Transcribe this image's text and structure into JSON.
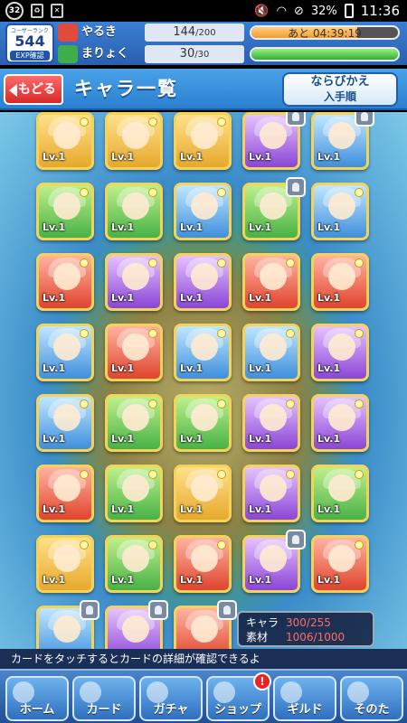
{
  "status_bar": {
    "notification_count": "32",
    "battery_percent": "32%",
    "time": "11:36"
  },
  "header": {
    "rank_label": "ユーザーランク",
    "rank_value": "544",
    "exp_label": "EXP確認",
    "stamina": {
      "name": "やるき",
      "current": "144",
      "max": "/200",
      "timer": "あと 04:39:19",
      "fill": 0.72
    },
    "magic": {
      "name": "まりょく",
      "current": "30",
      "max": "/30",
      "fill": 1.0
    }
  },
  "titlebar": {
    "back_label": "もどる",
    "title": "キャラ一覧",
    "sort_label": "ならびかえ",
    "sort_value": "入手順"
  },
  "cards": [
    {
      "color": "yellow",
      "lv": "Lv.1"
    },
    {
      "color": "yellow",
      "lv": "Lv.1"
    },
    {
      "color": "yellow",
      "lv": "Lv.1"
    },
    {
      "color": "purple",
      "lv": "Lv.1",
      "locked": true
    },
    {
      "color": "blue",
      "lv": "Lv.1",
      "locked": true
    },
    {
      "color": "green",
      "lv": "Lv.1"
    },
    {
      "color": "green",
      "lv": "Lv.1"
    },
    {
      "color": "blue",
      "lv": "Lv.1"
    },
    {
      "color": "green",
      "lv": "Lv.1",
      "locked": true
    },
    {
      "color": "blue",
      "lv": "Lv.1"
    },
    {
      "color": "red",
      "lv": "Lv.1"
    },
    {
      "color": "purple",
      "lv": "Lv.1"
    },
    {
      "color": "purple",
      "lv": "Lv.1"
    },
    {
      "color": "red",
      "lv": "Lv.1"
    },
    {
      "color": "red",
      "lv": "Lv.1"
    },
    {
      "color": "blue",
      "lv": "Lv.1"
    },
    {
      "color": "red",
      "lv": "Lv.1"
    },
    {
      "color": "blue",
      "lv": "Lv.1"
    },
    {
      "color": "blue",
      "lv": "Lv.1"
    },
    {
      "color": "purple",
      "lv": "Lv.1"
    },
    {
      "color": "blue",
      "lv": "Lv.1"
    },
    {
      "color": "green",
      "lv": "Lv.1"
    },
    {
      "color": "green",
      "lv": "Lv.1"
    },
    {
      "color": "purple",
      "lv": "Lv.1"
    },
    {
      "color": "purple",
      "lv": "Lv.1"
    },
    {
      "color": "red",
      "lv": "Lv.1"
    },
    {
      "color": "green",
      "lv": "Lv.1"
    },
    {
      "color": "yellow",
      "lv": "Lv.1"
    },
    {
      "color": "purple",
      "lv": "Lv.1"
    },
    {
      "color": "green",
      "lv": "Lv.1"
    },
    {
      "color": "yellow",
      "lv": "Lv.1"
    },
    {
      "color": "green",
      "lv": "Lv.1"
    },
    {
      "color": "red",
      "lv": "Lv.1"
    },
    {
      "color": "purple",
      "lv": "Lv.1",
      "locked": true
    },
    {
      "color": "red",
      "lv": "Lv.1"
    },
    {
      "color": "blue",
      "lv": "",
      "locked": true
    },
    {
      "color": "purple",
      "lv": "",
      "locked": true
    },
    {
      "color": "red",
      "lv": "",
      "locked": true
    }
  ],
  "counter": {
    "chara_label": "キャラ",
    "chara_value": "300/255",
    "material_label": "素材",
    "material_value": "1006/1000"
  },
  "hint_text": "カードをタッチするとカードの詳細が確認できるよ",
  "bottom_nav": [
    {
      "label": "ホーム",
      "icon": "home-icon"
    },
    {
      "label": "カード",
      "icon": "card-icon"
    },
    {
      "label": "ガチャ",
      "icon": "gacha-icon"
    },
    {
      "label": "ショップ",
      "icon": "shop-icon",
      "badge": "!"
    },
    {
      "label": "ギルド",
      "icon": "guild-icon"
    },
    {
      "label": "そのた",
      "icon": "other-icon"
    }
  ]
}
